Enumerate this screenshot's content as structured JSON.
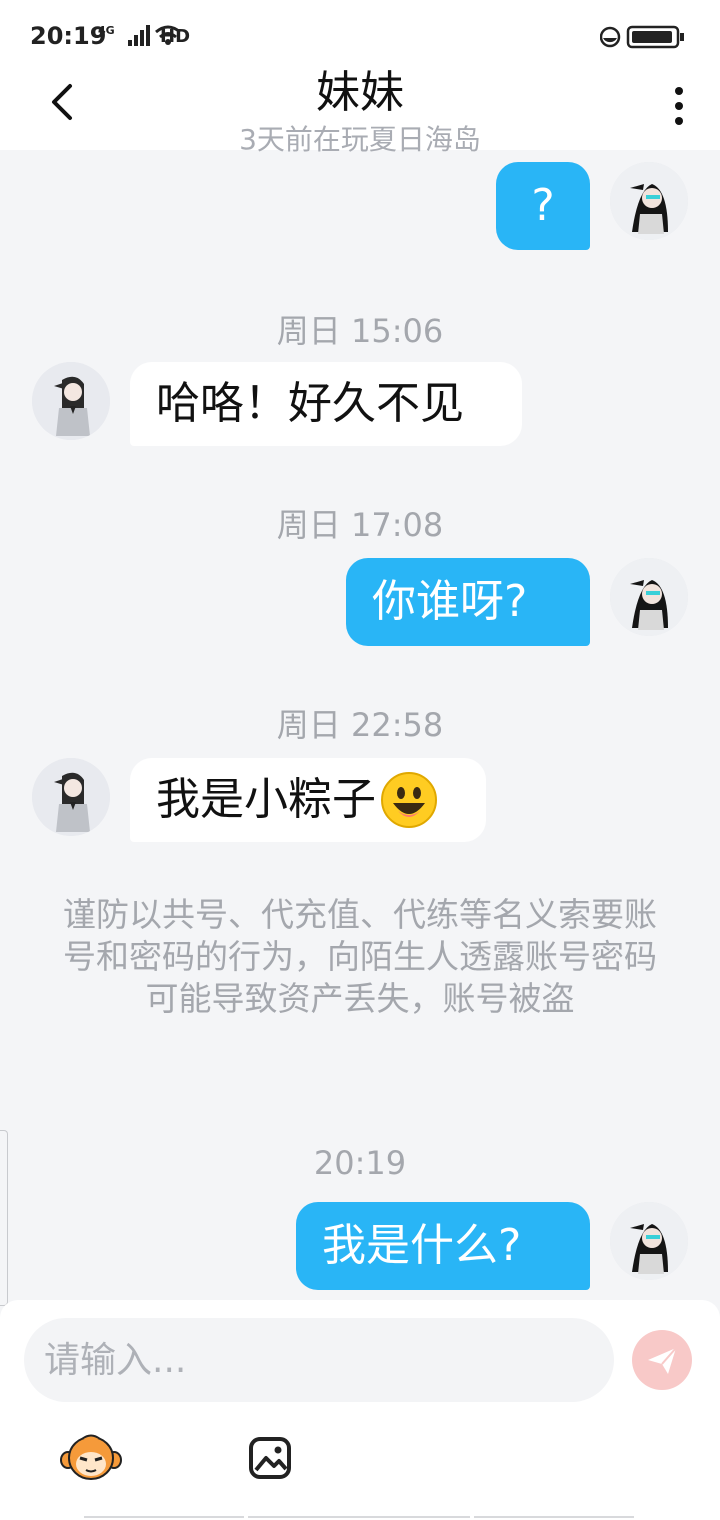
{
  "status_bar": {
    "time": "20:19",
    "signal_label": "4G",
    "hd_label": "HD"
  },
  "header": {
    "title": "妹妹",
    "subtitle": "3天前在玩夏日海岛"
  },
  "messages": [
    {
      "type": "outgoing",
      "text": "?"
    },
    {
      "type": "time",
      "text": "周日 15:06"
    },
    {
      "type": "incoming",
      "text": "哈咯！好久不见"
    },
    {
      "type": "time",
      "text": "周日 17:08"
    },
    {
      "type": "outgoing",
      "text": "你谁呀?"
    },
    {
      "type": "time",
      "text": "周日 22:58"
    },
    {
      "type": "incoming",
      "text": "我是小粽子"
    },
    {
      "type": "notice",
      "text": "谨防以共号、代充值、代练等名义索要账号和密码的行为，向陌生人透露账号密码可能导致资产丢失，账号被盗"
    },
    {
      "type": "time",
      "text": "20:19"
    },
    {
      "type": "outgoing",
      "text": "我是什么?"
    }
  ],
  "composer": {
    "placeholder": "请输入..."
  },
  "colors": {
    "outgoing_bubble": "#29b5f6",
    "incoming_bubble": "#ffffff",
    "background": "#f4f5f7",
    "send_button": "#f8c9c8"
  }
}
